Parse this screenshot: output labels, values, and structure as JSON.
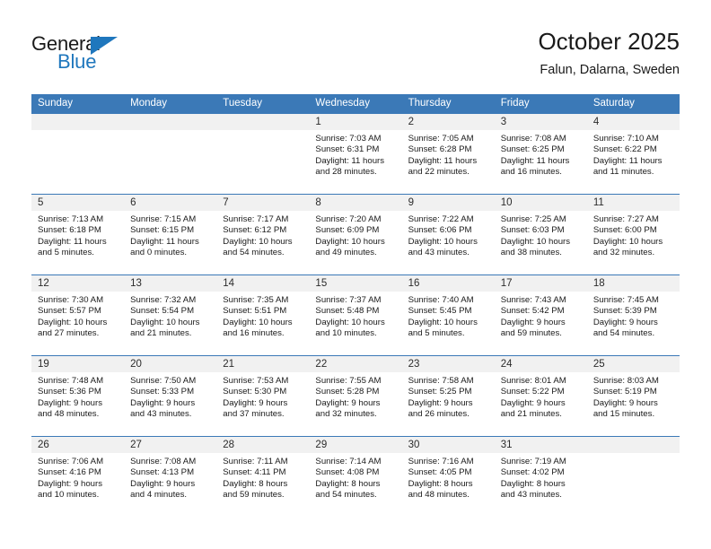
{
  "brand": {
    "name_top": "General",
    "name_bottom": "Blue"
  },
  "header": {
    "title": "October 2025",
    "location": "Falun, Dalarna, Sweden"
  },
  "colors": {
    "header_blue": "#3b79b7",
    "brand_blue": "#1f77bd",
    "daynum_band": "#f1f1f1"
  },
  "weekdays": [
    "Sunday",
    "Monday",
    "Tuesday",
    "Wednesday",
    "Thursday",
    "Friday",
    "Saturday"
  ],
  "weeks": [
    [
      {
        "day": "",
        "sunrise": "",
        "sunset": "",
        "daylight_1": "",
        "daylight_2": ""
      },
      {
        "day": "",
        "sunrise": "",
        "sunset": "",
        "daylight_1": "",
        "daylight_2": ""
      },
      {
        "day": "",
        "sunrise": "",
        "sunset": "",
        "daylight_1": "",
        "daylight_2": ""
      },
      {
        "day": "1",
        "sunrise": "Sunrise: 7:03 AM",
        "sunset": "Sunset: 6:31 PM",
        "daylight_1": "Daylight: 11 hours",
        "daylight_2": "and 28 minutes."
      },
      {
        "day": "2",
        "sunrise": "Sunrise: 7:05 AM",
        "sunset": "Sunset: 6:28 PM",
        "daylight_1": "Daylight: 11 hours",
        "daylight_2": "and 22 minutes."
      },
      {
        "day": "3",
        "sunrise": "Sunrise: 7:08 AM",
        "sunset": "Sunset: 6:25 PM",
        "daylight_1": "Daylight: 11 hours",
        "daylight_2": "and 16 minutes."
      },
      {
        "day": "4",
        "sunrise": "Sunrise: 7:10 AM",
        "sunset": "Sunset: 6:22 PM",
        "daylight_1": "Daylight: 11 hours",
        "daylight_2": "and 11 minutes."
      }
    ],
    [
      {
        "day": "5",
        "sunrise": "Sunrise: 7:13 AM",
        "sunset": "Sunset: 6:18 PM",
        "daylight_1": "Daylight: 11 hours",
        "daylight_2": "and 5 minutes."
      },
      {
        "day": "6",
        "sunrise": "Sunrise: 7:15 AM",
        "sunset": "Sunset: 6:15 PM",
        "daylight_1": "Daylight: 11 hours",
        "daylight_2": "and 0 minutes."
      },
      {
        "day": "7",
        "sunrise": "Sunrise: 7:17 AM",
        "sunset": "Sunset: 6:12 PM",
        "daylight_1": "Daylight: 10 hours",
        "daylight_2": "and 54 minutes."
      },
      {
        "day": "8",
        "sunrise": "Sunrise: 7:20 AM",
        "sunset": "Sunset: 6:09 PM",
        "daylight_1": "Daylight: 10 hours",
        "daylight_2": "and 49 minutes."
      },
      {
        "day": "9",
        "sunrise": "Sunrise: 7:22 AM",
        "sunset": "Sunset: 6:06 PM",
        "daylight_1": "Daylight: 10 hours",
        "daylight_2": "and 43 minutes."
      },
      {
        "day": "10",
        "sunrise": "Sunrise: 7:25 AM",
        "sunset": "Sunset: 6:03 PM",
        "daylight_1": "Daylight: 10 hours",
        "daylight_2": "and 38 minutes."
      },
      {
        "day": "11",
        "sunrise": "Sunrise: 7:27 AM",
        "sunset": "Sunset: 6:00 PM",
        "daylight_1": "Daylight: 10 hours",
        "daylight_2": "and 32 minutes."
      }
    ],
    [
      {
        "day": "12",
        "sunrise": "Sunrise: 7:30 AM",
        "sunset": "Sunset: 5:57 PM",
        "daylight_1": "Daylight: 10 hours",
        "daylight_2": "and 27 minutes."
      },
      {
        "day": "13",
        "sunrise": "Sunrise: 7:32 AM",
        "sunset": "Sunset: 5:54 PM",
        "daylight_1": "Daylight: 10 hours",
        "daylight_2": "and 21 minutes."
      },
      {
        "day": "14",
        "sunrise": "Sunrise: 7:35 AM",
        "sunset": "Sunset: 5:51 PM",
        "daylight_1": "Daylight: 10 hours",
        "daylight_2": "and 16 minutes."
      },
      {
        "day": "15",
        "sunrise": "Sunrise: 7:37 AM",
        "sunset": "Sunset: 5:48 PM",
        "daylight_1": "Daylight: 10 hours",
        "daylight_2": "and 10 minutes."
      },
      {
        "day": "16",
        "sunrise": "Sunrise: 7:40 AM",
        "sunset": "Sunset: 5:45 PM",
        "daylight_1": "Daylight: 10 hours",
        "daylight_2": "and 5 minutes."
      },
      {
        "day": "17",
        "sunrise": "Sunrise: 7:43 AM",
        "sunset": "Sunset: 5:42 PM",
        "daylight_1": "Daylight: 9 hours",
        "daylight_2": "and 59 minutes."
      },
      {
        "day": "18",
        "sunrise": "Sunrise: 7:45 AM",
        "sunset": "Sunset: 5:39 PM",
        "daylight_1": "Daylight: 9 hours",
        "daylight_2": "and 54 minutes."
      }
    ],
    [
      {
        "day": "19",
        "sunrise": "Sunrise: 7:48 AM",
        "sunset": "Sunset: 5:36 PM",
        "daylight_1": "Daylight: 9 hours",
        "daylight_2": "and 48 minutes."
      },
      {
        "day": "20",
        "sunrise": "Sunrise: 7:50 AM",
        "sunset": "Sunset: 5:33 PM",
        "daylight_1": "Daylight: 9 hours",
        "daylight_2": "and 43 minutes."
      },
      {
        "day": "21",
        "sunrise": "Sunrise: 7:53 AM",
        "sunset": "Sunset: 5:30 PM",
        "daylight_1": "Daylight: 9 hours",
        "daylight_2": "and 37 minutes."
      },
      {
        "day": "22",
        "sunrise": "Sunrise: 7:55 AM",
        "sunset": "Sunset: 5:28 PM",
        "daylight_1": "Daylight: 9 hours",
        "daylight_2": "and 32 minutes."
      },
      {
        "day": "23",
        "sunrise": "Sunrise: 7:58 AM",
        "sunset": "Sunset: 5:25 PM",
        "daylight_1": "Daylight: 9 hours",
        "daylight_2": "and 26 minutes."
      },
      {
        "day": "24",
        "sunrise": "Sunrise: 8:01 AM",
        "sunset": "Sunset: 5:22 PM",
        "daylight_1": "Daylight: 9 hours",
        "daylight_2": "and 21 minutes."
      },
      {
        "day": "25",
        "sunrise": "Sunrise: 8:03 AM",
        "sunset": "Sunset: 5:19 PM",
        "daylight_1": "Daylight: 9 hours",
        "daylight_2": "and 15 minutes."
      }
    ],
    [
      {
        "day": "26",
        "sunrise": "Sunrise: 7:06 AM",
        "sunset": "Sunset: 4:16 PM",
        "daylight_1": "Daylight: 9 hours",
        "daylight_2": "and 10 minutes."
      },
      {
        "day": "27",
        "sunrise": "Sunrise: 7:08 AM",
        "sunset": "Sunset: 4:13 PM",
        "daylight_1": "Daylight: 9 hours",
        "daylight_2": "and 4 minutes."
      },
      {
        "day": "28",
        "sunrise": "Sunrise: 7:11 AM",
        "sunset": "Sunset: 4:11 PM",
        "daylight_1": "Daylight: 8 hours",
        "daylight_2": "and 59 minutes."
      },
      {
        "day": "29",
        "sunrise": "Sunrise: 7:14 AM",
        "sunset": "Sunset: 4:08 PM",
        "daylight_1": "Daylight: 8 hours",
        "daylight_2": "and 54 minutes."
      },
      {
        "day": "30",
        "sunrise": "Sunrise: 7:16 AM",
        "sunset": "Sunset: 4:05 PM",
        "daylight_1": "Daylight: 8 hours",
        "daylight_2": "and 48 minutes."
      },
      {
        "day": "31",
        "sunrise": "Sunrise: 7:19 AM",
        "sunset": "Sunset: 4:02 PM",
        "daylight_1": "Daylight: 8 hours",
        "daylight_2": "and 43 minutes."
      },
      {
        "day": "",
        "sunrise": "",
        "sunset": "",
        "daylight_1": "",
        "daylight_2": ""
      }
    ]
  ]
}
